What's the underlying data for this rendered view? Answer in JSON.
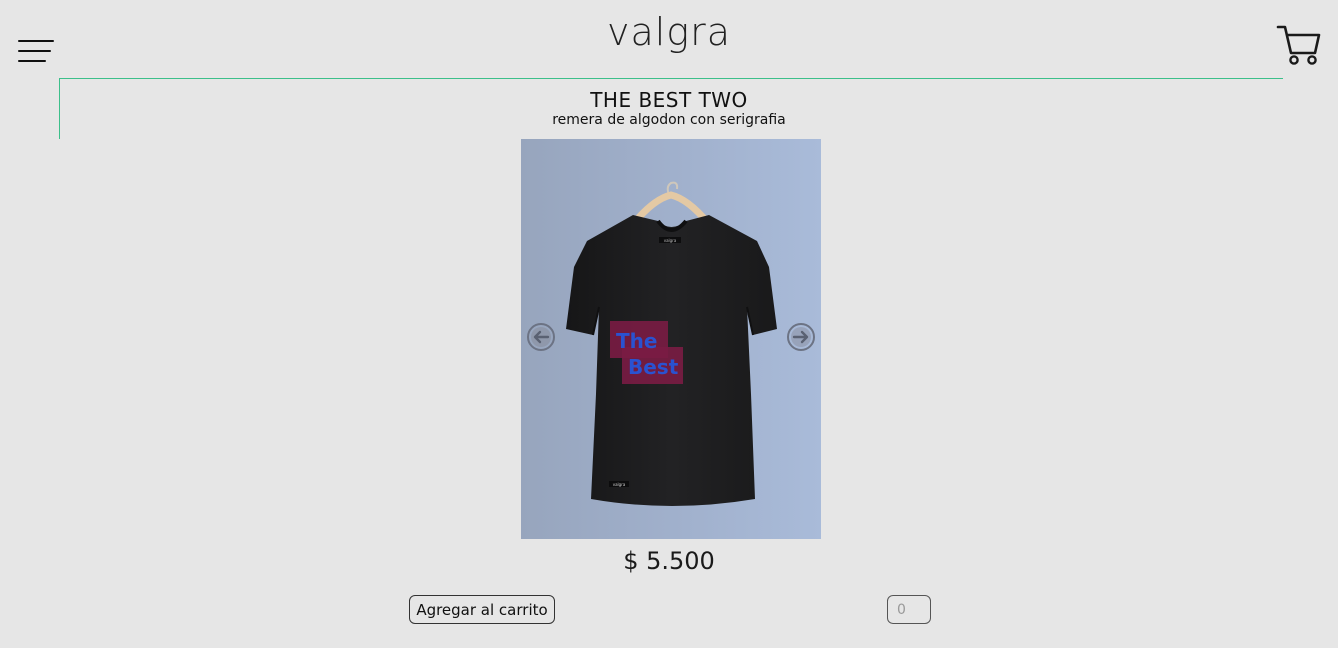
{
  "header": {
    "brand": "valgra",
    "menu_icon": "hamburger-menu-icon",
    "cart_icon": "shopping-cart-icon"
  },
  "product": {
    "title": "THE BEST TWO",
    "subtitle": "remera de algodon con serigrafia",
    "image": {
      "print_text_line1": "The",
      "print_text_line2": "Best",
      "collar_label": "valgra",
      "hem_label": "valgra",
      "prev_icon": "arrow-left-circle-icon",
      "next_icon": "arrow-right-circle-icon"
    },
    "price": "$ 5.500",
    "add_to_cart_label": "Agregar al carrito",
    "quantity_placeholder": "0"
  },
  "colors": {
    "background": "#e6e6e6",
    "accent_line": "#3cbf8a",
    "shirt": "#1e1e1f",
    "print_box": "#8a1f4a",
    "print_text": "#2a52d0"
  }
}
